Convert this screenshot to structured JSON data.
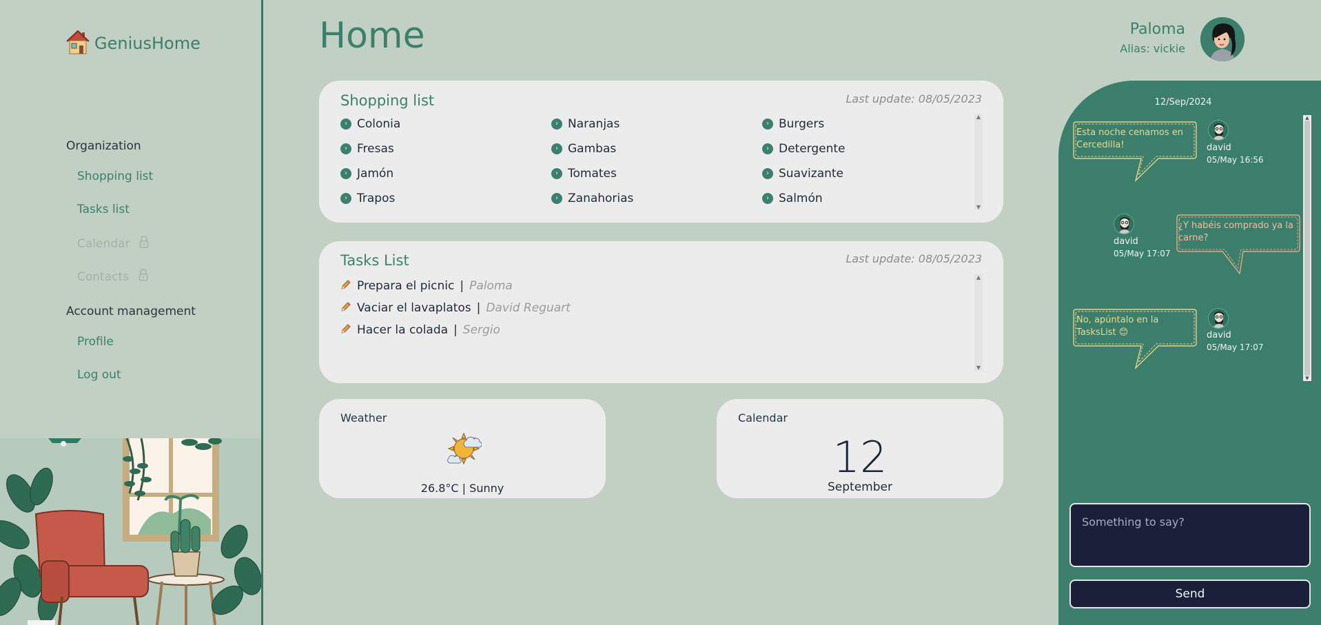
{
  "app": {
    "name": "GeniusHome"
  },
  "sidebar": {
    "sections": [
      {
        "heading": "Organization",
        "items": [
          {
            "label": "Shopping list",
            "enabled": true
          },
          {
            "label": "Tasks list",
            "enabled": true
          },
          {
            "label": "Calendar",
            "enabled": false
          },
          {
            "label": "Contacts",
            "enabled": false
          }
        ]
      },
      {
        "heading": "Account management",
        "items": [
          {
            "label": "Profile",
            "enabled": true
          },
          {
            "label": "Log out",
            "enabled": true
          }
        ]
      }
    ]
  },
  "header": {
    "title": "Home",
    "user": {
      "name": "Paloma",
      "alias": "Alias: vickie"
    }
  },
  "shopping": {
    "title": "Shopping list",
    "last_update": "Last update: 08/05/2023",
    "items": [
      "Colonia",
      "Naranjas",
      "Burgers",
      "Fresas",
      "Gambas",
      "Detergente",
      "Jamón",
      "Tomates",
      "Suavizante",
      "Trapos",
      "Zanahorias",
      "Salmón"
    ]
  },
  "tasks": {
    "title": "Tasks List",
    "last_update": "Last update: 08/05/2023",
    "separator": "|",
    "items": [
      {
        "task": "Prepara el picnic",
        "assignee": "Paloma"
      },
      {
        "task": "Vaciar el lavaplatos",
        "assignee": "David Reguart"
      },
      {
        "task": "Hacer la colada",
        "assignee": "Sergio"
      }
    ]
  },
  "weather": {
    "label": "Weather",
    "icon": "sun-cloud-icon",
    "summary": "26.8°C | Sunny"
  },
  "calendar": {
    "label": "Calendar",
    "day": "12",
    "month": "September"
  },
  "chat": {
    "date": "12/Sep/2024",
    "messages": [
      {
        "text": "Esta noche cenamos en Cercedilla!",
        "author": "david",
        "time": "05/May 16:56",
        "side": "left"
      },
      {
        "text": "¿Y habéis comprado ya la carne?",
        "author": "david",
        "time": "05/May 17:07",
        "side": "right"
      },
      {
        "text": "No, apúntalo en la TasksList 😊",
        "author": "david",
        "time": "05/May 17:07",
        "side": "left"
      }
    ],
    "input_placeholder": "Something to say?",
    "send_label": "Send"
  },
  "colors": {
    "background": "#c1d0c3",
    "accent": "#3b7f6c",
    "card": "#ececec",
    "dark": "#1a1f3a",
    "bubble_text": "#f1d98a"
  }
}
